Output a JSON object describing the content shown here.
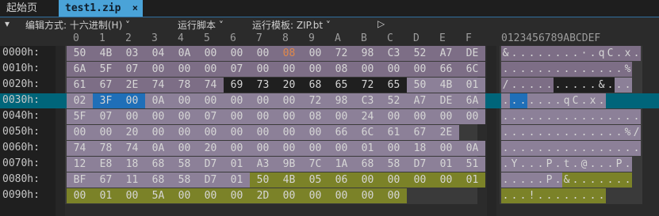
{
  "tabs": {
    "start_label": "起始页",
    "file_label": "test1.zip",
    "close_glyph": "×"
  },
  "toolbar": {
    "collapse_glyph": "▾",
    "edit_mode_label": "编辑方式: 十六进制(H) ˅",
    "run_script_label": "运行脚本 ˅",
    "run_template_label": "运行模板: ZIP.bt ˅",
    "play_glyph": "▷"
  },
  "column_headers": [
    "0",
    "1",
    "2",
    "3",
    "4",
    "5",
    "6",
    "7",
    "8",
    "9",
    "A",
    "B",
    "C",
    "D",
    "E",
    "F"
  ],
  "ascii_header": "0123456789ABCDEF",
  "rows": [
    {
      "address": "0000h:",
      "bytes": [
        "50",
        "4B",
        "03",
        "04",
        "0A",
        "00",
        "00",
        "00",
        "08",
        "00",
        "72",
        "98",
        "C3",
        "52",
        "A7",
        "DE"
      ],
      "ascii": "&........·.qC.x."
    },
    {
      "address": "0010h:",
      "bytes": [
        "6A",
        "5F",
        "07",
        "00",
        "00",
        "00",
        "07",
        "00",
        "00",
        "00",
        "08",
        "00",
        "00",
        "00",
        "66",
        "6C"
      ],
      "ascii": "..............%"
    },
    {
      "address": "0020h:",
      "bytes": [
        "61",
        "67",
        "2E",
        "74",
        "78",
        "74",
        "69",
        "73",
        "20",
        "68",
        "65",
        "72",
        "65",
        "50",
        "4B",
        "01"
      ],
      "ascii": "/..........&..."
    },
    {
      "address": "0030h:",
      "bytes": [
        "02",
        "3F",
        "00",
        "0A",
        "00",
        "00",
        "00",
        "00",
        "00",
        "72",
        "98",
        "C3",
        "52",
        "A7",
        "DE",
        "6A"
      ],
      "ascii": ".......qC.x."
    },
    {
      "address": "0040h:",
      "bytes": [
        "5F",
        "07",
        "00",
        "00",
        "00",
        "07",
        "00",
        "00",
        "00",
        "08",
        "00",
        "24",
        "00",
        "00",
        "00",
        "00"
      ],
      "ascii": "................"
    },
    {
      "address": "0050h:",
      "bytes": [
        "00",
        "00",
        "20",
        "00",
        "00",
        "00",
        "00",
        "00",
        "00",
        "00",
        "66",
        "6C",
        "61",
        "67",
        "2E"
      ],
      "ascii": "..............%/."
    },
    {
      "address": "0060h:",
      "bytes": [
        "74",
        "78",
        "74",
        "0A",
        "00",
        "20",
        "00",
        "00",
        "00",
        "00",
        "00",
        "01",
        "00",
        "18",
        "00",
        "0A"
      ],
      "ascii": "................"
    },
    {
      "address": "0070h:",
      "bytes": [
        "12",
        "E8",
        "18",
        "68",
        "58",
        "D7",
        "01",
        "A3",
        "9B",
        "7C",
        "1A",
        "68",
        "58",
        "D7",
        "01",
        "51"
      ],
      "ascii": ".Y...P.t.@...P."
    },
    {
      "address": "0080h:",
      "bytes": [
        "BF",
        "67",
        "11",
        "68",
        "58",
        "D7",
        "01",
        "50",
        "4B",
        "05",
        "06",
        "00",
        "00",
        "00",
        "00",
        "01"
      ],
      "ascii": ".....P.&......."
    },
    {
      "address": "0090h:",
      "bytes": [
        "00",
        "01",
        "00",
        "5A",
        "00",
        "00",
        "00",
        "2D",
        "00",
        "00",
        "00",
        "00",
        "00"
      ],
      "ascii": "...!........"
    }
  ],
  "colors": {
    "zip_local_header": "#7d6e86",
    "filename": "#1f1f1f",
    "central_dir": "#8c8098",
    "end_record": "#7b8228",
    "selected": "#1f6fb8",
    "orange_byte": "#e0884a"
  }
}
